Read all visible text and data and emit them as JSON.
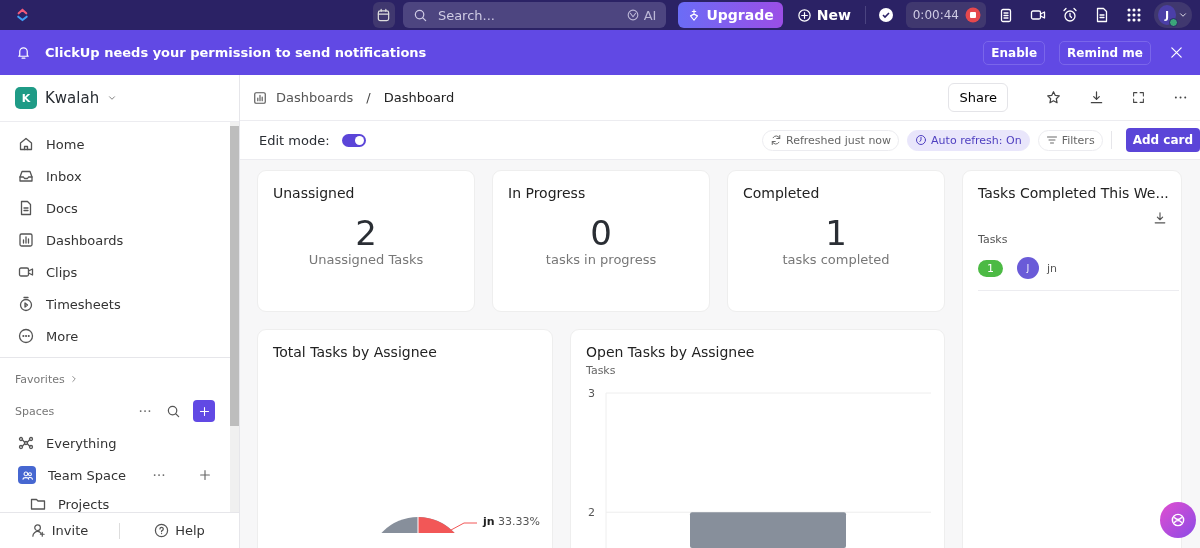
{
  "topbar": {
    "search": {
      "placeholder": "Search..."
    },
    "ai": "AI",
    "upgrade": "Upgrade",
    "new": "New",
    "timer": "0:00:44",
    "avatar": "J"
  },
  "banner": {
    "message": "ClickUp needs your permission to send notifications",
    "buttons": [
      "Enable",
      "Remind me"
    ]
  },
  "sidebar": {
    "workspace": {
      "initial": "K",
      "name": "Kwalah"
    },
    "items": [
      {
        "kind": "home",
        "label": "Home",
        "selected": false
      },
      {
        "kind": "inbox",
        "label": "Inbox",
        "selected": false
      },
      {
        "kind": "docs",
        "label": "Docs",
        "selected": false
      },
      {
        "kind": "dashboards",
        "label": "Dashboards",
        "selected": false
      },
      {
        "kind": "clips",
        "label": "Clips",
        "selected": false
      },
      {
        "kind": "timesheets",
        "label": "Timesheets",
        "selected": false
      },
      {
        "kind": "more",
        "label": "More",
        "selected": false
      }
    ],
    "favorites": "Favorites",
    "spaces": "Spaces",
    "space_items": [
      {
        "kind": "everything",
        "label": "Everything"
      },
      {
        "kind": "team",
        "label": "Team Space"
      },
      {
        "kind": "folder",
        "label": "Projects"
      }
    ],
    "footer": [
      "Invite",
      "Help"
    ]
  },
  "header": {
    "breadcrumb": [
      "Dashboards",
      "Dashboard"
    ],
    "separator": "/",
    "share": "Share"
  },
  "toolbar": {
    "edit_mode": {
      "label": "Edit mode:",
      "on": true
    },
    "refreshed": "Refreshed just now",
    "auto_refresh": "Auto refresh: On",
    "filters": "Filters",
    "add_card": "Add card"
  },
  "stat_cards": [
    {
      "title": "Unassigned",
      "value": "2",
      "caption": "Unassigned Tasks"
    },
    {
      "title": "In Progress",
      "value": "0",
      "caption": "tasks in progress"
    },
    {
      "title": "Completed",
      "value": "1",
      "caption": "tasks completed"
    }
  ],
  "week_card": {
    "title": "Tasks Completed This We...",
    "column": "Tasks",
    "rows": [
      {
        "count": "1",
        "avatar": "J",
        "name": "jn"
      }
    ]
  },
  "pie_card": {
    "title": "Total Tasks by Assignee",
    "label_name": "jn",
    "label_value": "33.33%"
  },
  "bar_card": {
    "title": "Open Tasks by Assignee",
    "chart_data": {
      "type": "bar",
      "ylabel": "Tasks",
      "values": [
        2
      ],
      "ylim": [
        1.7,
        3
      ],
      "yticks": [
        2,
        3
      ]
    }
  }
}
